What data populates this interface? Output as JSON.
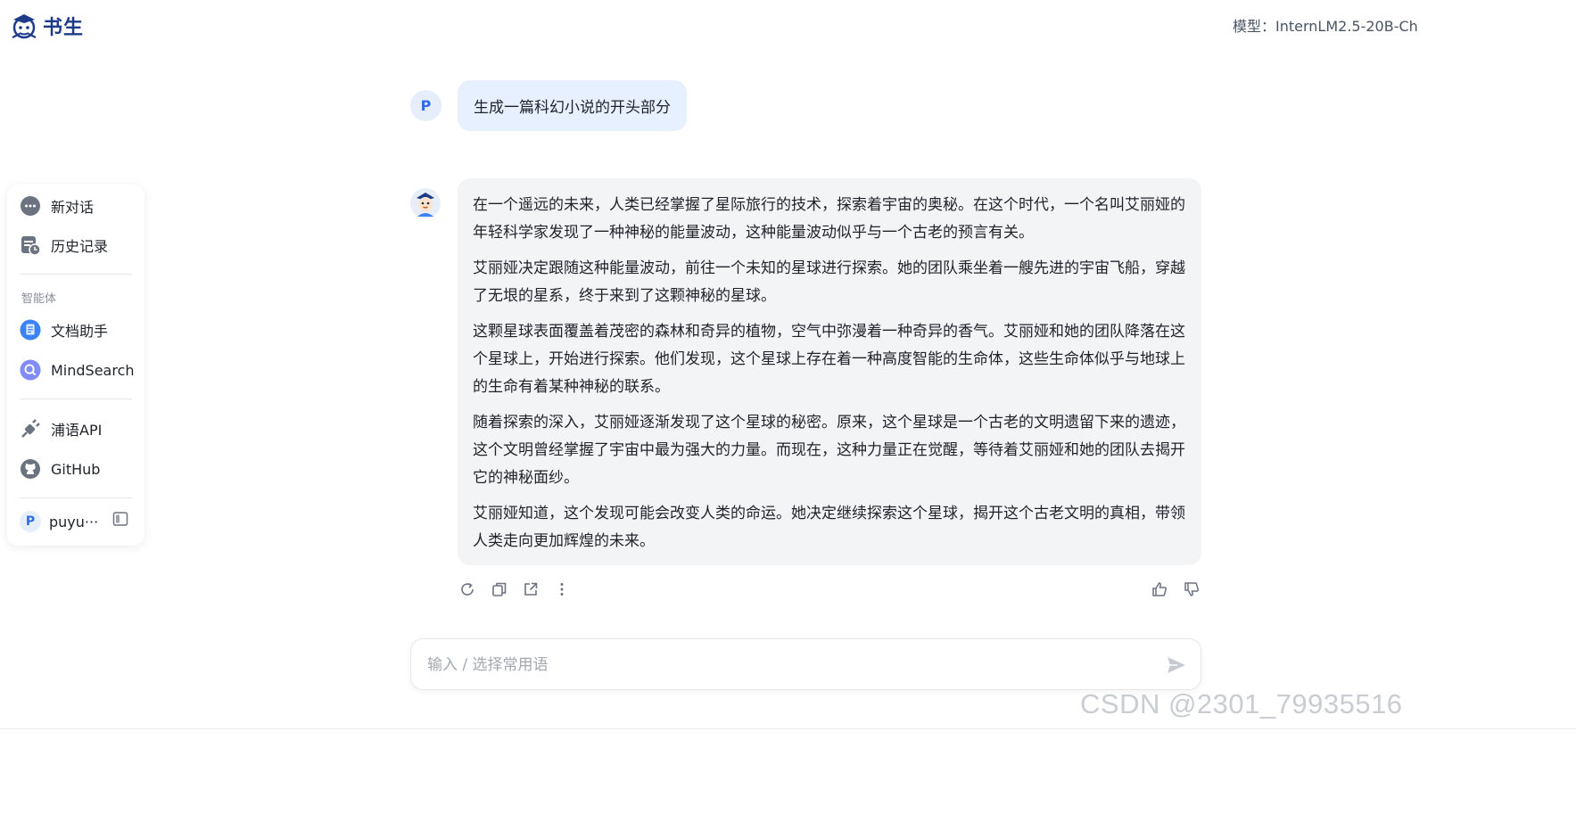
{
  "app": {
    "logo_text": "书生",
    "model_label": "模型：InternLM2.5-20B-Ch"
  },
  "sidebar": {
    "new_chat": "新对话",
    "history": "历史记录",
    "section_agents": "智能体",
    "agents": [
      "文档助手",
      "MindSearch"
    ],
    "links": [
      "浦语API",
      "GitHub"
    ],
    "user": {
      "initial": "P",
      "name": "puyu···"
    }
  },
  "chat": {
    "user_initial": "P",
    "user_message": "生成一篇科幻小说的开头部分",
    "assistant_paragraphs": [
      "在一个遥远的未来，人类已经掌握了星际旅行的技术，探索着宇宙的奥秘。在这个时代，一个名叫艾丽娅的年轻科学家发现了一种神秘的能量波动，这种能量波动似乎与一个古老的预言有关。",
      "艾丽娅决定跟随这种能量波动，前往一个未知的星球进行探索。她的团队乘坐着一艘先进的宇宙飞船，穿越了无垠的星系，终于来到了这颗神秘的星球。",
      "这颗星球表面覆盖着茂密的森林和奇异的植物，空气中弥漫着一种奇异的香气。艾丽娅和她的团队降落在这个星球上，开始进行探索。他们发现，这个星球上存在着一种高度智能的生命体，这些生命体似乎与地球上的生命有着某种神秘的联系。",
      "随着探索的深入，艾丽娅逐渐发现了这个星球的秘密。原来，这个星球是一个古老的文明遗留下来的遗迹，这个文明曾经掌握了宇宙中最为强大的力量。而现在，这种力量正在觉醒，等待着艾丽娅和她的团队去揭开它的神秘面纱。",
      "艾丽娅知道，这个发现可能会改变人类的命运。她决定继续探索这个星球，揭开这个古老文明的真相，带领人类走向更加辉煌的未来。"
    ]
  },
  "input": {
    "placeholder": "输入 / 选择常用语"
  },
  "watermark": "CSDN @2301_79935516",
  "colors": {
    "accent": "#2f6bea",
    "user_bubble": "#e7f0fe",
    "bot_bubble": "#f3f4f6"
  }
}
